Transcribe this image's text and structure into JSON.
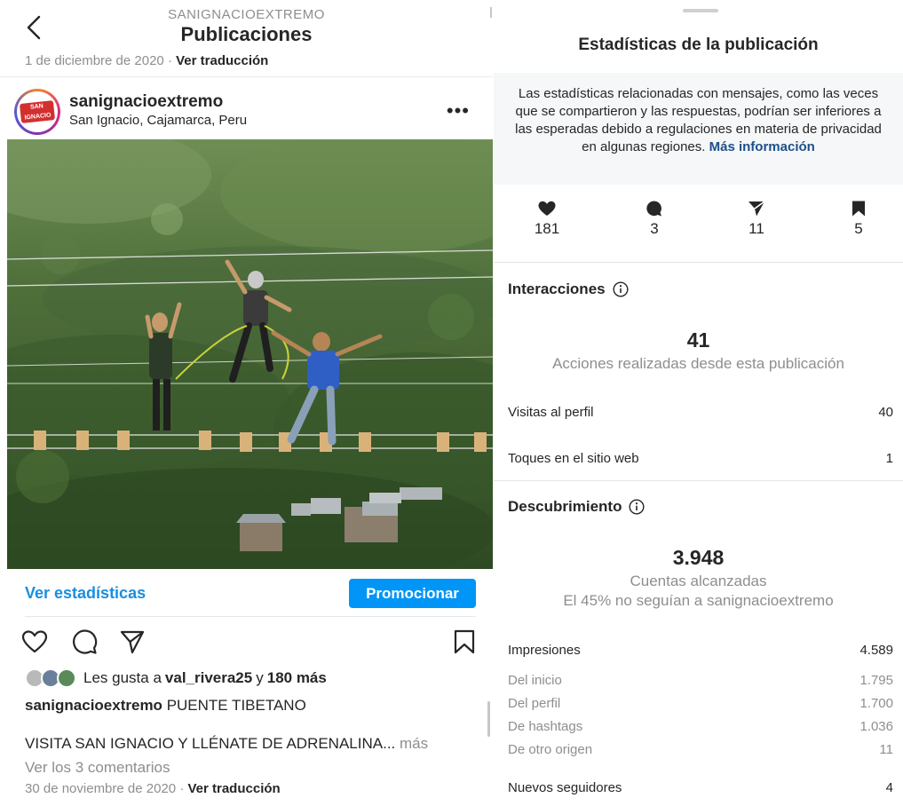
{
  "left": {
    "header": {
      "username": "SANIGNACIOEXTREMO",
      "title": "Publicaciones"
    },
    "prev_post": {
      "date": "1 de diciembre de 2020",
      "separator": "·",
      "translate": "Ver traducción"
    },
    "post": {
      "username": "sanignacioextremo",
      "location": "San Ignacio, Cajamarca, Peru",
      "more_icon": "more-horizontal-icon",
      "avatar_text": "SAN IGNACIO EXTREMO"
    },
    "stats_link": "Ver estadísticas",
    "promote_button": "Promocionar",
    "icons": [
      "heart-icon",
      "comment-icon",
      "share-icon",
      "bookmark-icon"
    ],
    "likes": {
      "prefix": "Les gusta a",
      "user": "val_rivera25",
      "connector": "y",
      "others": "180 más"
    },
    "caption": {
      "username": "sanignacioextremo",
      "text": "PUENTE TIBETANO",
      "line2": "VISITA SAN IGNACIO Y LLÉNATE DE ADRENALINA...",
      "more": "más"
    },
    "comments": "Ver los 3 comentarios",
    "date": "30 de noviembre de 2020",
    "separator": "·",
    "translate": "Ver traducción"
  },
  "right": {
    "title": "Estadísticas de la publicación",
    "notice": "Las estadísticas relacionadas con mensajes, como las veces que se compartieron y las respuestas, podrían ser inferiores a las esperadas debido a regulaciones en materia de privacidad en algunas regiones.",
    "notice_link": "Más información",
    "metrics": {
      "likes": "181",
      "comments": "3",
      "shares": "11",
      "saves": "5"
    },
    "interactions": {
      "title": "Interacciones",
      "total": "41",
      "subtitle": "Acciones realizadas desde esta publicación",
      "rows": [
        {
          "label": "Visitas al perfil",
          "value": "40"
        },
        {
          "label": "Toques en el sitio web",
          "value": "1"
        }
      ]
    },
    "discovery": {
      "title": "Descubrimiento",
      "total": "3.948",
      "subtitle": "Cuentas alcanzadas",
      "subtitle2": "El 45% no seguían a sanignacioextremo",
      "impressions": {
        "label": "Impresiones",
        "value": "4.589"
      },
      "sources": [
        {
          "label": "Del inicio",
          "value": "1.795"
        },
        {
          "label": "Del perfil",
          "value": "1.700"
        },
        {
          "label": "De hashtags",
          "value": "1.036"
        },
        {
          "label": "De otro origen",
          "value": "11"
        }
      ],
      "followers": {
        "label": "Nuevos seguidores",
        "value": "4"
      }
    }
  }
}
